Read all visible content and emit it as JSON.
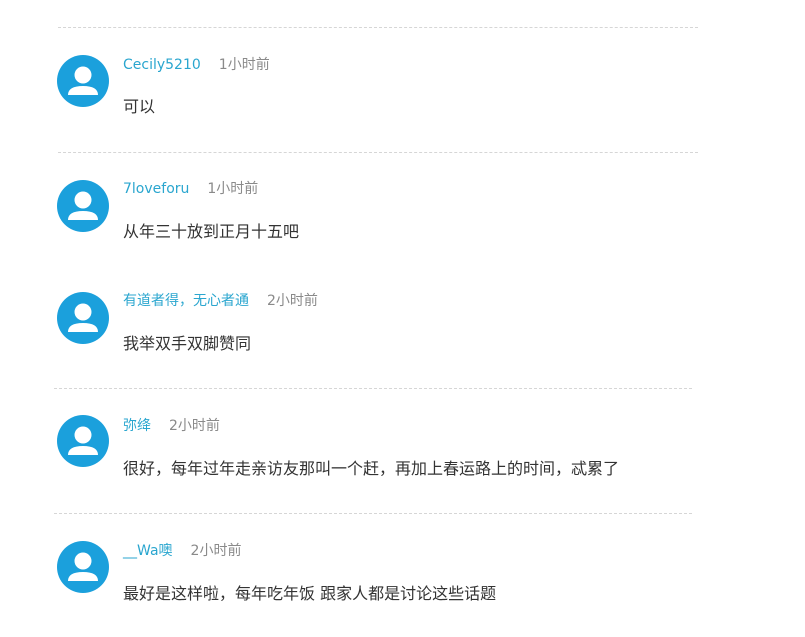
{
  "comments": [
    {
      "username": "Cecily5210",
      "time": "1小时前",
      "text": "可以"
    },
    {
      "username": "7loveforu",
      "time": "1小时前",
      "text": "从年三十放到正月十五吧"
    },
    {
      "username": "有道者得，无心者通",
      "time": "2小时前",
      "text": "我举双手双脚赞同"
    },
    {
      "username": "弥绛",
      "time": "2小时前",
      "text": "很好，每年过年走亲访友那叫一个赶，再加上春运路上的时间，忒累了"
    },
    {
      "username": "__Wa噢",
      "time": "2小时前",
      "text": "最好是这样啦，每年吃年饭  跟家人都是讨论这些话题"
    }
  ],
  "avatar_icon": "default-user-icon",
  "colors": {
    "avatar": "#1ba0dc",
    "username": "#2aa6cf",
    "time": "#8a8a8a",
    "text": "#333333",
    "divider": "#d6d6d6"
  }
}
